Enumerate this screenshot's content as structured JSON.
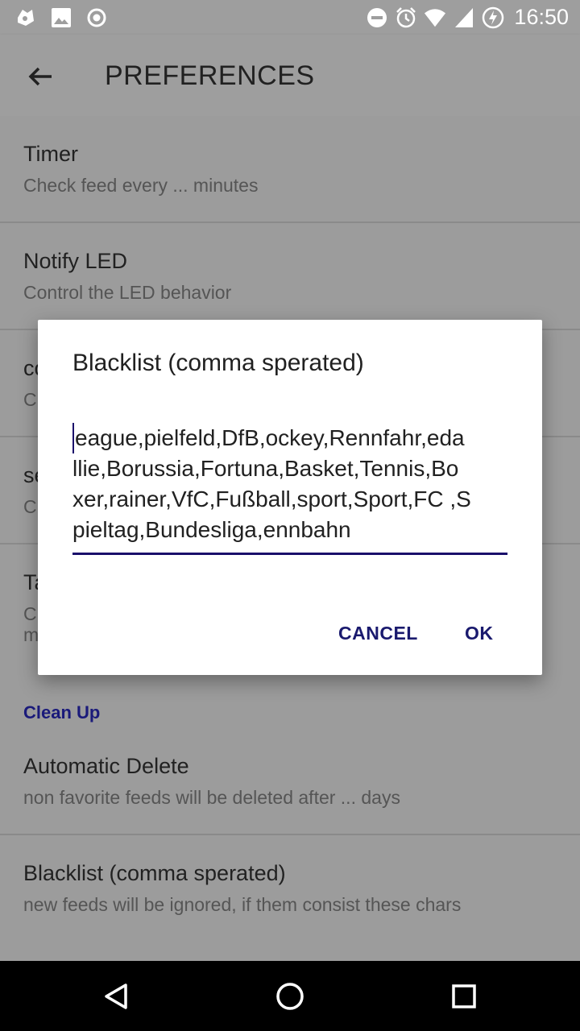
{
  "status_bar": {
    "time": "16:50",
    "left_icons": [
      "app-notification-icon",
      "image-icon",
      "record-icon"
    ],
    "right_icons": [
      "do-not-disturb-icon",
      "alarm-icon",
      "wifi-icon",
      "signal-icon",
      "battery-charging-icon"
    ]
  },
  "app_bar": {
    "title": "PREFERENCES",
    "back_icon": "arrow-back-icon"
  },
  "preferences": [
    {
      "title": "Timer",
      "summary": "Check feed every ... minutes"
    },
    {
      "title": "Notify LED",
      "summary": "Control the LED behavior"
    },
    {
      "title": "co",
      "summary": "Cl"
    },
    {
      "title": "se",
      "summary": "Cl"
    },
    {
      "title": "Ta",
      "summary": "Cl\nm"
    }
  ],
  "category": {
    "label": "Clean Up"
  },
  "cleanup_items": [
    {
      "title": "Automatic Delete",
      "summary": "non favorite feeds will be deleted after ... days"
    },
    {
      "title": "Blacklist (comma sperated)",
      "summary": "new feeds will be ignored, if them consist these chars"
    }
  ],
  "dialog": {
    "title": "Blacklist (comma sperated)",
    "input_value": "eague,pielfeld,DfB,ockey,Rennfahr,edallie,Borussia,Fortuna,Basket,Tennis,Boxer,rainer,VfC,Fußball,sport,Sport,FC ,Spieltag,Bundesliga,ennbahn",
    "input_lines": [
      "eague,pielfeld,DfB,ockey,Rennfahr,eda",
      "llie,Borussia,Fortuna,Basket,Tennis,Bo",
      "xer,rainer,VfC,Fußball,sport,Sport,FC ,S",
      "pieltag,Bundesliga,ennbahn"
    ],
    "cancel_label": "CANCEL",
    "ok_label": "OK"
  },
  "nav_bar": {
    "icons": [
      "back-triangle-icon",
      "home-circle-icon",
      "recents-square-icon"
    ]
  },
  "colors": {
    "accent": "#1a0f6b",
    "dim_background": "#9c9c9c"
  }
}
